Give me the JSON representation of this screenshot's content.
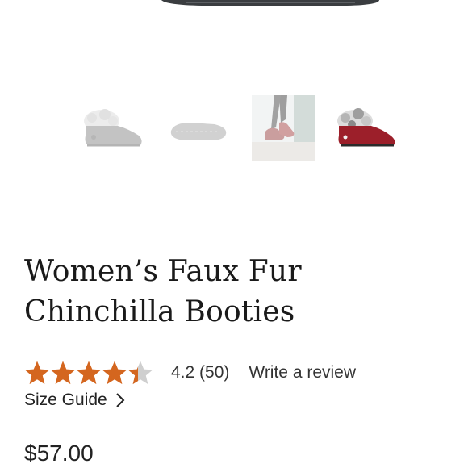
{
  "product": {
    "title_line1": "Women’s Faux Fur",
    "title_line2": "Chinchilla Booties",
    "rating_value": 4.2,
    "rating_text": "4.2 (50)",
    "review_link": "Write a review",
    "size_guide": "Size Guide",
    "price": "$57.00"
  },
  "thumbnails": [
    {
      "name": "grey-bootie-side",
      "selected": false
    },
    {
      "name": "bootie-sole",
      "selected": false
    },
    {
      "name": "bootie-worn-street",
      "selected": false
    },
    {
      "name": "red-bootie-side",
      "selected": true
    }
  ],
  "colors": {
    "star_filled": "#d4661f",
    "star_empty": "#cfcfcf",
    "text": "#222222"
  }
}
